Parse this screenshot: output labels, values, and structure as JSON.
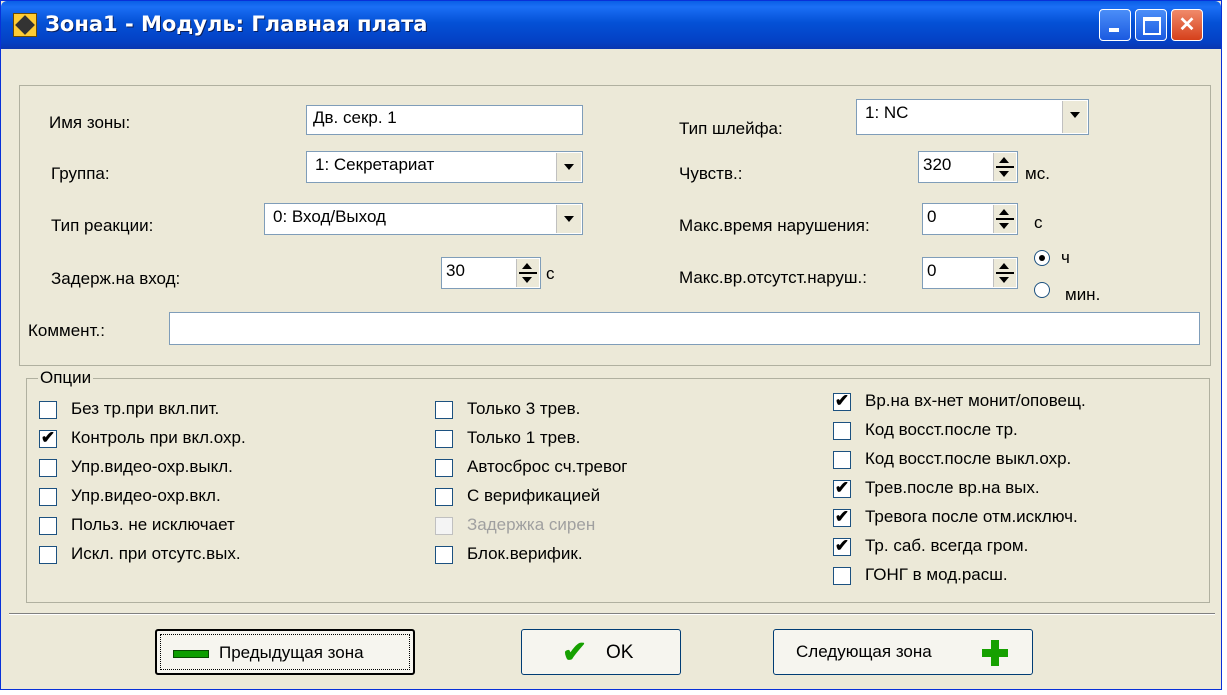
{
  "window": {
    "title": "Зона1  - Модуль: Главная плата"
  },
  "fields": {
    "zone_name": {
      "label": "Имя зоны:",
      "value": "Дв. секр. 1"
    },
    "group": {
      "label": "Группа:",
      "value": "1: Секретариат"
    },
    "reaction": {
      "label": "Тип реакции:",
      "value": "0: Вход/Выход"
    },
    "entry_delay": {
      "label": "Задерж.на вход:",
      "value": "30",
      "unit": "с"
    },
    "loop_type": {
      "label": "Тип шлейфа:",
      "value": "1: NC"
    },
    "sensitivity": {
      "label": "Чувств.:",
      "value": "320",
      "unit": "мс."
    },
    "max_violation": {
      "label": "Макс.время нарушения:",
      "value": "0",
      "unit": "с"
    },
    "max_absence": {
      "label": "Макс.вр.отсутст.наруш.:",
      "value": "0"
    },
    "unit_radio": {
      "hours": "ч",
      "minutes": "мин.",
      "selected": "hours"
    },
    "comment": {
      "label": "Коммент.:",
      "value": ""
    }
  },
  "options": {
    "title": "Опции",
    "col1": [
      {
        "label": "Без тр.при вкл.пит.",
        "checked": false,
        "disabled": false
      },
      {
        "label": "Контроль при вкл.охр.",
        "checked": true,
        "disabled": false
      },
      {
        "label": "Упр.видео-охр.выкл.",
        "checked": false,
        "disabled": false
      },
      {
        "label": "Упр.видео-охр.вкл.",
        "checked": false,
        "disabled": false
      },
      {
        "label": "Польз. не исключает",
        "checked": false,
        "disabled": false
      },
      {
        "label": "Искл. при отсутс.вых.",
        "checked": false,
        "disabled": false
      }
    ],
    "col2": [
      {
        "label": "Только 3 трев.",
        "checked": false,
        "disabled": false
      },
      {
        "label": "Только 1 трев.",
        "checked": false,
        "disabled": false
      },
      {
        "label": "Автосброс сч.тревог",
        "checked": false,
        "disabled": false
      },
      {
        "label": "С верификацией",
        "checked": false,
        "disabled": false
      },
      {
        "label": "Задержка сирен",
        "checked": false,
        "disabled": true
      },
      {
        "label": "Блок.верифик.",
        "checked": false,
        "disabled": false
      }
    ],
    "col3": [
      {
        "label": "Вр.на вх-нет монит/оповещ.",
        "checked": true,
        "disabled": false
      },
      {
        "label": "Код восст.после тр.",
        "checked": false,
        "disabled": false
      },
      {
        "label": "Код восст.после выкл.охр.",
        "checked": false,
        "disabled": false
      },
      {
        "label": "Трев.после вр.на вых.",
        "checked": true,
        "disabled": false
      },
      {
        "label": "Тревога после отм.исключ.",
        "checked": true,
        "disabled": false
      },
      {
        "label": "Тр. саб. всегда гром.",
        "checked": true,
        "disabled": false
      },
      {
        "label": "ГОНГ в мод.расш.",
        "checked": false,
        "disabled": false
      }
    ]
  },
  "buttons": {
    "prev": "Предыдущая зона",
    "ok": "OK",
    "next": "Следующая зона"
  },
  "colors": {
    "titlebar": "#0451d6",
    "face": "#ece9d8",
    "check_green": "#16a000",
    "minus_green": "#0d9e00"
  }
}
